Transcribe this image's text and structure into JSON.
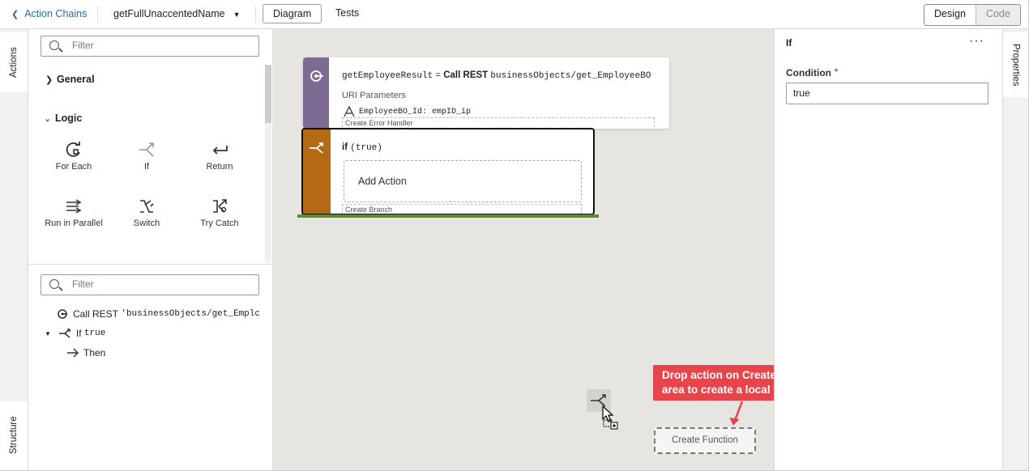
{
  "header": {
    "back_label": "Action Chains",
    "chain_name": "getFullUnaccentedName",
    "tabs": [
      "Diagram",
      "Tests"
    ],
    "view_modes": [
      "Design",
      "Code"
    ]
  },
  "left_rail": {
    "actions_tab": "Actions",
    "structure_tab": "Structure"
  },
  "actions_panel": {
    "filter_placeholder": "Filter",
    "general_label": "General",
    "logic_label": "Logic",
    "logic_items": [
      {
        "label": "For Each",
        "icon": "for-each-icon"
      },
      {
        "label": "If",
        "icon": "if-icon"
      },
      {
        "label": "Return",
        "icon": "return-icon"
      },
      {
        "label": "Run in Parallel",
        "icon": "run-in-parallel-icon"
      },
      {
        "label": "Switch",
        "icon": "switch-icon"
      },
      {
        "label": "Try Catch",
        "icon": "try-catch-icon"
      }
    ]
  },
  "structure_panel": {
    "filter_placeholder": "Filter",
    "items": [
      {
        "label": "Call REST",
        "code": "'businessObjects/get_Emplc"
      },
      {
        "label": "If",
        "code": "true"
      },
      {
        "label": "Then"
      }
    ]
  },
  "canvas": {
    "rest_card": {
      "result_var": "getEmployeeResult",
      "equals": "=",
      "call_label": "Call REST",
      "endpoint": "businessObjects/get_EmployeeBO",
      "uri_params_label": "URI Parameters",
      "param_text": "EmployeeBO_Id: empID_ip",
      "error_handler_label": "Create Error Handler"
    },
    "if_card": {
      "keyword": "if",
      "condition": "(true)",
      "add_action_label": "Add Action",
      "create_branch_label": "Create Branch"
    },
    "callout_line1": "Drop action on Create Function",
    "callout_line2": "area to create a local function",
    "create_function_label": "Create Function"
  },
  "properties": {
    "tab_label": "Properties",
    "title": "If",
    "more_label": "···",
    "condition_label": "Condition",
    "required_marker": "*",
    "condition_value": "true"
  },
  "colors": {
    "rest_stripe": "#7d6b94",
    "if_stripe": "#b46a14",
    "green_bar": "#5d8a33",
    "callout": "#e6454b",
    "link": "#2d6ca2"
  }
}
